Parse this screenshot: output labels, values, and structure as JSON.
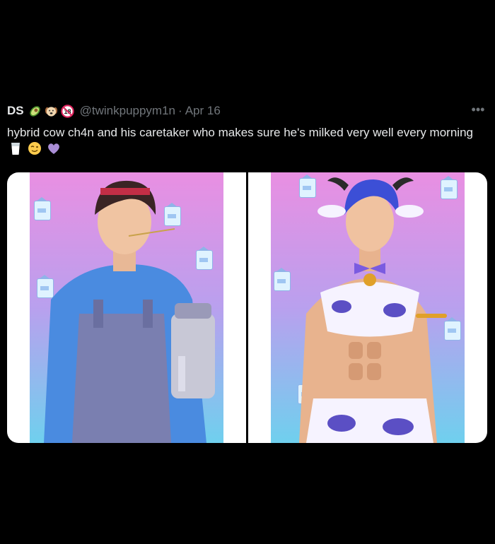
{
  "tweet": {
    "display_name": "DS",
    "handle": "@twinkpuppym1n",
    "separator": "·",
    "date": "Apr 16",
    "more_label": "•••",
    "text": "hybrid cow ch4n and his caretaker who makes sure he's milked very well every morning",
    "badge_icons": [
      "avocado-icon",
      "puppy-face-icon",
      "no-under-18-icon"
    ],
    "text_emoji_icons": [
      "glass-of-milk-icon",
      "winking-face-icon",
      "purple-heart-icon"
    ]
  },
  "colors": {
    "background": "#000000",
    "text_primary": "#e7e9ea",
    "text_secondary": "#71767b",
    "art_pink": "#e98fe2",
    "art_blue": "#6fd0ee"
  }
}
